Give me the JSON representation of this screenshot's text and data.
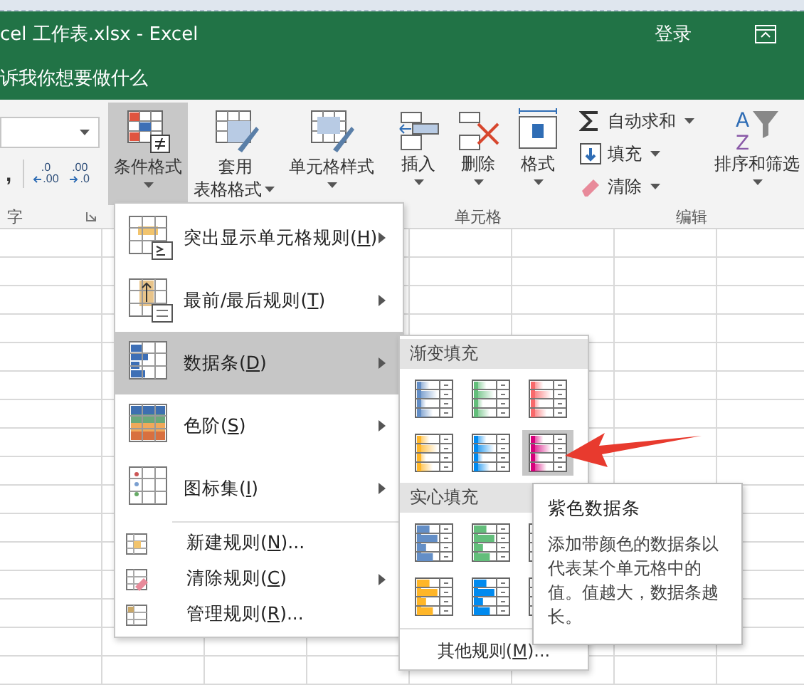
{
  "window": {
    "title": "cel 工作表.xlsx  -  Excel",
    "sign_in": "登录"
  },
  "tell_me": "诉我你想要做什么",
  "ribbon": {
    "comma": ",",
    "decimal_buttons": [
      {
        "kind": "increase",
        "top": ".0",
        "bottom": ".00"
      },
      {
        "kind": "decrease",
        "top": ".00",
        "bottom": ".0"
      }
    ],
    "number_label": "字",
    "style_buttons": [
      {
        "kind": "conditional",
        "lines": [
          "条件格式"
        ],
        "pressed": true
      },
      {
        "kind": "table",
        "lines": [
          "套用",
          "表格格式"
        ],
        "pressed": false
      },
      {
        "kind": "cell_style",
        "lines": [
          "单元格样式"
        ],
        "pressed": false
      }
    ],
    "cell_buttons": [
      {
        "kind": "insert",
        "label": "插入"
      },
      {
        "kind": "delete",
        "label": "删除"
      },
      {
        "kind": "format",
        "label": "格式"
      }
    ],
    "cells_label": "单元格",
    "edit_buttons": [
      {
        "kind": "sum",
        "label": "自动求和"
      },
      {
        "kind": "fill",
        "label": "填充"
      },
      {
        "kind": "clear",
        "label": "清除"
      }
    ],
    "sort_button": "排序和筛选",
    "sort_letters": [
      "A",
      "Z"
    ],
    "editing_label": "编辑"
  },
  "menu": {
    "items": [
      {
        "kind": "highlight",
        "label": "突出显示单元格规则(",
        "key": "H",
        "after": ")",
        "submenu": true,
        "selected": false
      },
      {
        "kind": "top",
        "label": "最前/最后规则(",
        "key": "T",
        "after": ")",
        "submenu": true,
        "selected": false
      },
      {
        "kind": "databar",
        "label": "数据条(",
        "key": "D",
        "after": ")",
        "submenu": true,
        "selected": true
      },
      {
        "kind": "colorscale",
        "label": "色阶(",
        "key": "S",
        "after": ")",
        "submenu": true,
        "selected": false
      },
      {
        "kind": "iconset",
        "label": "图标集(",
        "key": "I",
        "after": ")",
        "submenu": true,
        "selected": false
      }
    ],
    "rule_items": [
      {
        "kind": "new",
        "label": "新建规则(",
        "key": "N",
        "after": ")...",
        "submenu": false
      },
      {
        "kind": "clear",
        "label": "清除规则(",
        "key": "C",
        "after": ")",
        "submenu": true
      },
      {
        "kind": "manage",
        "label": "管理规则(",
        "key": "R",
        "after": ")...",
        "submenu": false
      }
    ]
  },
  "submenu": {
    "sections": [
      {
        "title": "渐变填充",
        "kind": "gradient",
        "swatches": [
          {
            "color": "#638ec6",
            "selected": false
          },
          {
            "color": "#63be7b",
            "selected": false
          },
          {
            "color": "#f8696b",
            "selected": false
          },
          {
            "color": "#ffb628",
            "selected": false
          },
          {
            "color": "#008aef",
            "selected": false
          },
          {
            "color": "#d6007b",
            "selected": true
          }
        ]
      },
      {
        "title": "实心填充",
        "kind": "solid",
        "swatches": [
          {
            "color": "#638ec6",
            "selected": false
          },
          {
            "color": "#63be7b",
            "selected": false
          },
          {
            "selected": false
          },
          {
            "color": "#ffb628",
            "selected": false
          },
          {
            "color": "#008aef",
            "selected": false
          },
          {
            "selected": false
          }
        ]
      }
    ],
    "footer": {
      "label": "其他规则(",
      "key": "M",
      "after": ")..."
    }
  },
  "tooltip": {
    "title": "紫色数据条",
    "body": "添加带颜色的数据条以代表某个单元格中的值。值越大，数据条越长。"
  }
}
